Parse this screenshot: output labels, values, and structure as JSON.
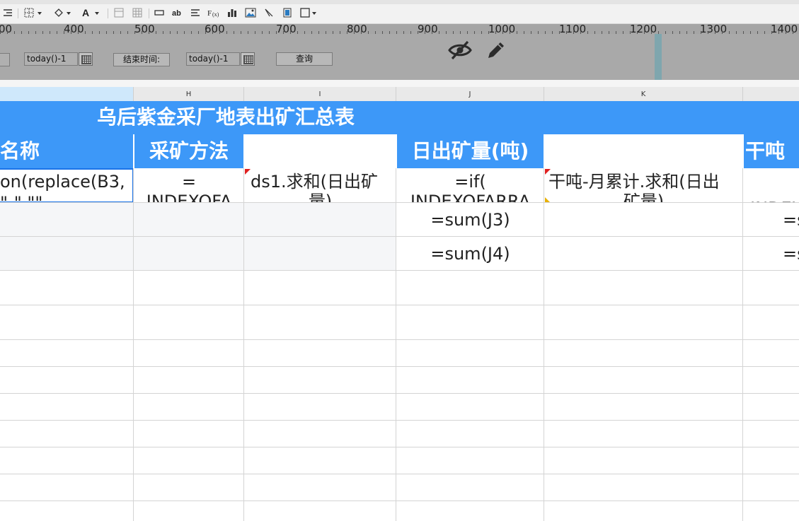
{
  "ruler": {
    "labels": [
      "00",
      "400",
      "500",
      "600",
      "700",
      "800",
      "900",
      "1000",
      "1100",
      "1200",
      "1300",
      "1400"
    ]
  },
  "params": {
    "start_value": "today()-1",
    "end_label": "结束时间:",
    "end_value": "today()-1",
    "query_label": "查询"
  },
  "icons": {
    "hide": "eye-slash-icon",
    "edit": "pencil-icon"
  },
  "columns": [
    "H",
    "I",
    "J",
    "K"
  ],
  "sheet": {
    "title": "乌后紫金采厂地表出矿汇总表",
    "headers": [
      "名称",
      "采矿方法",
      "",
      "日出矿量(吨)",
      "",
      "干吨"
    ],
    "row3": {
      "g": "on(replace(B3,",
      "g2": "\"-\",\"\"",
      "h": "=",
      "h2": "INDEXOFA",
      "i": "ds1.求和(日出矿",
      "i2": "量)",
      "j": "=if(",
      "j2": "INDEXOFARRA",
      "k": "干吨-月累计.求和(日出",
      "k2": "矿量)",
      "l": "INDEX"
    },
    "row4": {
      "j": "=sum(J3)",
      "l": "=s"
    },
    "row5": {
      "j": "=sum(J4)",
      "l": "=s"
    }
  },
  "colors": {
    "header_blue": "#3d98f8",
    "param_gray": "#a9a9a9",
    "selection_blue": "#1a73e8"
  }
}
